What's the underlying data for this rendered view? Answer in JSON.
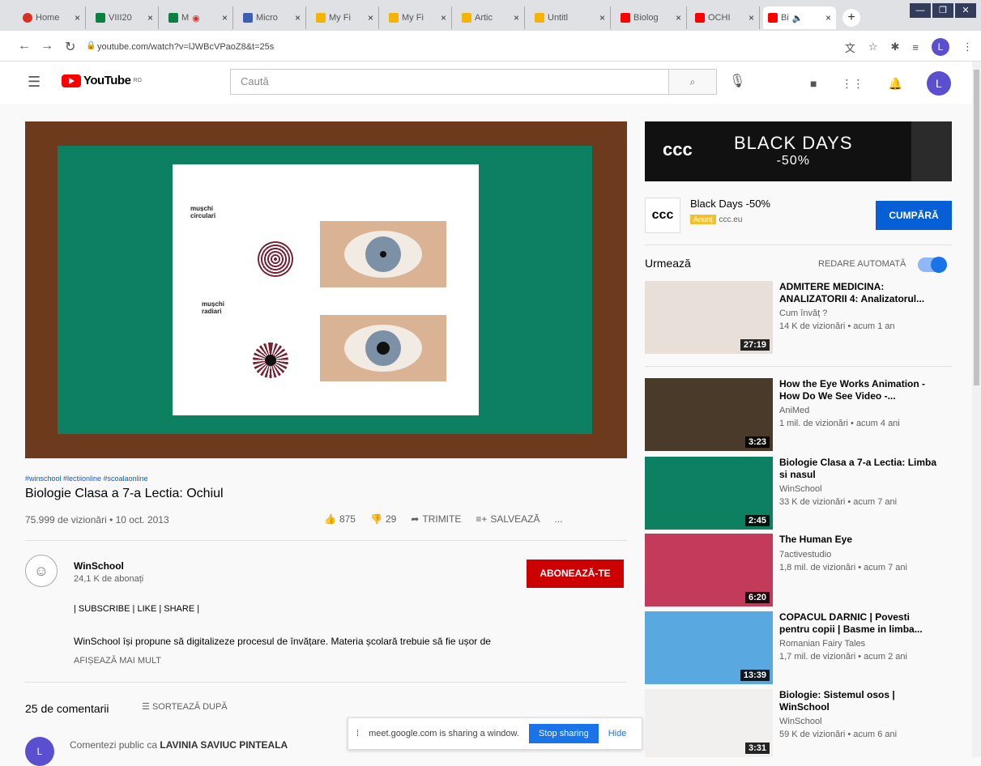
{
  "browser": {
    "tabs": [
      {
        "label": "Home",
        "color": "#d93025"
      },
      {
        "label": "VIII20",
        "color": "#0b8043"
      },
      {
        "label": "M",
        "color": "#0b8043"
      },
      {
        "label": "Micro",
        "color": "#3c5fb4"
      },
      {
        "label": "My Fi",
        "color": "#f4b400"
      },
      {
        "label": "My Fi",
        "color": "#f4b400"
      },
      {
        "label": "Artic",
        "color": "#f4b400"
      },
      {
        "label": "Untitl",
        "color": "#f4b400"
      },
      {
        "label": "Biolog",
        "color": "#f00"
      },
      {
        "label": "OCHI",
        "color": "#f00"
      },
      {
        "label": "Bi",
        "color": "#f00"
      }
    ],
    "url": "youtube.com/watch?v=lJWBcVPaoZ8&t=25s"
  },
  "youtube": {
    "region": "RO",
    "logo_text": "YouTube",
    "search_placeholder": "Caută"
  },
  "slide": {
    "label_circular": "mușchi circulari",
    "label_radial": "mușchi radiari"
  },
  "video": {
    "tags": "#winschool #lectiionline #scoalaonline",
    "title": "Biologie Clasa a 7-a Lectia: Ochiul",
    "views": "75.999 de vizionări • 10 oct. 2013",
    "likes": "875",
    "dislikes": "29",
    "share": "TRIMITE",
    "save": "SALVEAZĂ",
    "more": "..."
  },
  "channel": {
    "name": "WinSchool",
    "subs": "24,1 K de abonați",
    "subscribe": "ABONEAZĂ-TE",
    "desc1": "| SUBSCRIBE | LIKE | SHARE |",
    "desc2": "WinSchool își propune să digitalizeze procesul de învățare. Materia școlară trebuie să fie ușor de",
    "show_more": "AFIȘEAZĂ MAI MULT"
  },
  "comments": {
    "count": "25 de comentarii",
    "sort": "SORTEAZĂ DUPĂ",
    "avatar": "L",
    "prompt": "Comentezi public ca",
    "user": "LAVINIA SAVIUC PINTEALA"
  },
  "share_bar": {
    "text": "meet.google.com is sharing a window.",
    "stop": "Stop sharing",
    "hide": "Hide"
  },
  "ad": {
    "brand": "ccc",
    "headline": "BLACK DAYS",
    "discount": "-50%",
    "title": "Black Days -50%",
    "badge": "Anunț",
    "domain": "ccc.eu",
    "cta": "CUMPĂRĂ"
  },
  "upnext": {
    "label": "Urmează",
    "autoplay": "REDARE AUTOMATĂ"
  },
  "videos": [
    {
      "title": "ADMITERE MEDICINA: ANALIZATORII 4: Analizatorul...",
      "channel": "Cum învăț ?",
      "meta": "14 K de vizionări • acum 1 an",
      "duration": "27:19",
      "thumb": "#e8e0d8"
    },
    {
      "title": "How the Eye Works Animation - How Do We See Video -...",
      "channel": "AniMed",
      "meta": "1 mil. de vizionări • acum 4 ani",
      "duration": "3:23",
      "thumb": "#4a3a2a"
    },
    {
      "title": "Biologie Clasa a 7-a Lectia: Limba si nasul",
      "channel": "WinSchool",
      "meta": "33 K de vizionări • acum 7 ani",
      "duration": "2:45",
      "thumb": "#0e8062"
    },
    {
      "title": "The Human Eye",
      "channel": "7activestudio",
      "meta": "1,8 mil. de vizionări • acum 7 ani",
      "duration": "6:20",
      "thumb": "#c43a5a"
    },
    {
      "title": "COPACUL DARNIC | Povesti pentru copii | Basme in limba...",
      "channel": "Romanian Fairy Tales",
      "meta": "1,7 mil. de vizionări • acum 2 ani",
      "duration": "13:39",
      "thumb": "#5aa8e0"
    },
    {
      "title": "Biologie: Sistemul osos | WinSchool",
      "channel": "WinSchool",
      "meta": "59 K de vizionări • acum 6 ani",
      "duration": "3:31",
      "thumb": "#f2f0ee"
    }
  ]
}
